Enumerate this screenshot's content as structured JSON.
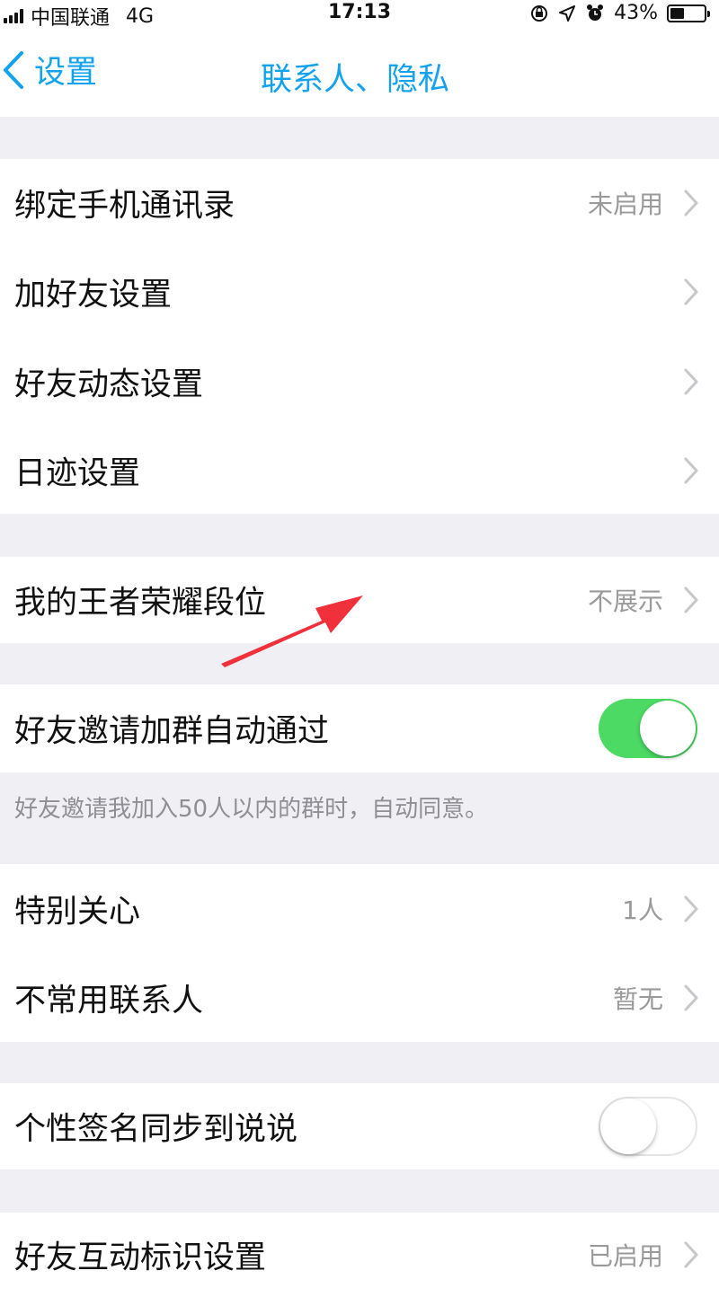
{
  "status_bar": {
    "carrier": "中国联通",
    "network": "4G",
    "time": "17:13",
    "battery": "43%",
    "battery_level": 0.43,
    "icons": [
      "signal-icon",
      "orientation-lock-icon",
      "location-icon",
      "alarm-icon",
      "battery-icon"
    ]
  },
  "nav": {
    "back_label": "设置",
    "title": "联系人、隐私"
  },
  "sections": {
    "contacts": {
      "bind_contacts": {
        "label": "绑定手机通讯录",
        "value": "未启用"
      },
      "add_friend": {
        "label": "加好友设置"
      },
      "friend_feed": {
        "label": "好友动态设置"
      },
      "footprint": {
        "label": "日迹设置"
      }
    },
    "game": {
      "rank": {
        "label": "我的王者荣耀段位",
        "value": "不展示"
      }
    },
    "group": {
      "auto_accept": {
        "label": "好友邀请加群自动通过",
        "toggle": true
      },
      "footnote": "好友邀请我加入50人以内的群时，自动同意。"
    },
    "care": {
      "special_care": {
        "label": "特别关心",
        "value": "1人"
      },
      "infrequent": {
        "label": "不常用联系人",
        "value": "暂无"
      }
    },
    "signature": {
      "sync_signature": {
        "label": "个性签名同步到说说",
        "toggle": false
      }
    },
    "interaction": {
      "interaction_marks": {
        "label": "好友互动标识设置",
        "value": "已启用"
      }
    }
  },
  "colors": {
    "accent": "#12a2ee",
    "toggle_on": "#4cd964",
    "annotation_arrow": "#f0303a",
    "background": "#efeff4"
  }
}
